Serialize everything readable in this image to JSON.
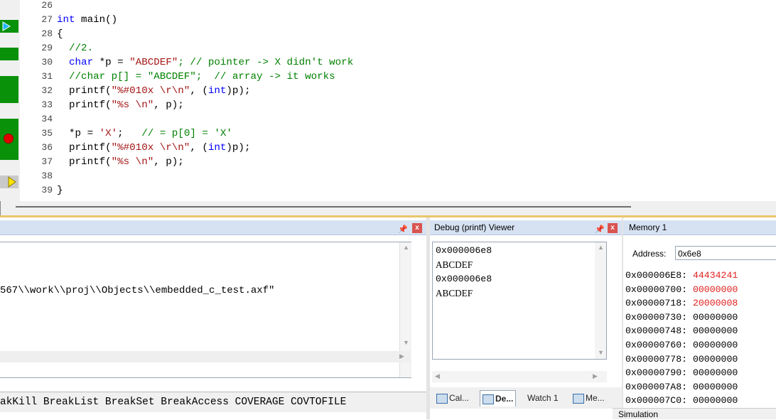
{
  "editor": {
    "lines": [
      {
        "num": "26",
        "code": ""
      },
      {
        "num": "27",
        "kw": "int",
        "rest": " main()"
      },
      {
        "num": "28",
        "code": "{"
      },
      {
        "num": "29",
        "comment": "  //2."
      },
      {
        "num": "30",
        "kw": "  char",
        "rest": " *p = ",
        "str": "\"ABCDEF\"",
        "comment": "; // pointer -> X didn't work"
      },
      {
        "num": "31",
        "comment": "  //char p[] = \"ABCDEF\";  // array -> it works"
      },
      {
        "num": "32",
        "code": "  printf(",
        "str": "\"%#010x \\r\\n\"",
        "rest": ", (",
        "kw2": "int",
        "rest2": ")p);"
      },
      {
        "num": "33",
        "code": "  printf(",
        "str": "\"%s \\n\"",
        "rest": ", p);"
      },
      {
        "num": "34",
        "code": ""
      },
      {
        "num": "35",
        "code": "  *p = ",
        "str": "'X'",
        "rest": ";   ",
        "comment": "// = p[0] = 'X'"
      },
      {
        "num": "36",
        "code": "  printf(",
        "str": "\"%#010x \\r\\n\"",
        "rest": ", (",
        "kw2": "int",
        "rest2": ")p);"
      },
      {
        "num": "37",
        "code": "  printf(",
        "str": "\"%s \\n\"",
        "rest": ", p);"
      },
      {
        "num": "38",
        "code": ""
      },
      {
        "num": "39",
        "code": "}"
      }
    ]
  },
  "command": {
    "output_line": "567\\\\work\\\\proj\\\\Objects\\\\embedded_c_test.axf\"",
    "help_line": "akKill BreakList BreakSet BreakAccess COVERAGE COVTOFILE"
  },
  "debug_viewer": {
    "title": "Debug (printf) Viewer",
    "lines": [
      "0x000006e8",
      "ABCDEF",
      "0x000006e8",
      "ABCDEF"
    ],
    "tabs": [
      "Cal...",
      "De...",
      "Watch 1",
      "Me..."
    ]
  },
  "memory": {
    "title": "Memory 1",
    "address_label": "Address:",
    "address_value": "0x6e8",
    "rows": [
      {
        "addr": "0x000006E8:",
        "val": "44434241",
        "highlight": true
      },
      {
        "addr": "0x00000700:",
        "val": "00000000",
        "highlight": true
      },
      {
        "addr": "0x00000718:",
        "val": "20000008",
        "highlight": true
      },
      {
        "addr": "0x00000730:",
        "val": "00000000",
        "highlight": false
      },
      {
        "addr": "0x00000748:",
        "val": "00000000",
        "highlight": false
      },
      {
        "addr": "0x00000760:",
        "val": "00000000",
        "highlight": false
      },
      {
        "addr": "0x00000778:",
        "val": "00000000",
        "highlight": false
      },
      {
        "addr": "0x00000790:",
        "val": "00000000",
        "highlight": false
      },
      {
        "addr": "0x000007A8:",
        "val": "00000000",
        "highlight": false
      },
      {
        "addr": "0x000007C0:",
        "val": "00000000",
        "highlight": false
      }
    ]
  },
  "status": {
    "mode": "Simulation"
  },
  "colors": {
    "coverage_green": "#0a910a",
    "breakpoint_red": "#e00000",
    "changed_value_red": "#e02020"
  }
}
